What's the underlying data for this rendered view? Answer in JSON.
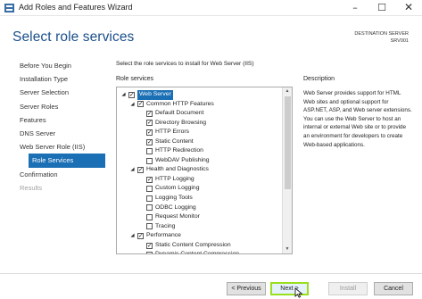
{
  "window": {
    "title": "Add Roles and Features Wizard",
    "controls": {
      "minimize": "–",
      "maximize": "☐",
      "close": "✕"
    }
  },
  "header": {
    "page_title": "Select role services",
    "destination_label": "DESTINATION SERVER",
    "destination_name": "SRV001"
  },
  "nav": {
    "items": [
      {
        "label": "Before You Begin",
        "state": "normal"
      },
      {
        "label": "Installation Type",
        "state": "normal"
      },
      {
        "label": "Server Selection",
        "state": "normal"
      },
      {
        "label": "Server Roles",
        "state": "normal"
      },
      {
        "label": "Features",
        "state": "normal"
      },
      {
        "label": "DNS Server",
        "state": "normal"
      },
      {
        "label": "Web Server Role (IIS)",
        "state": "normal"
      },
      {
        "label": "Role Services",
        "state": "active"
      },
      {
        "label": "Confirmation",
        "state": "normal"
      },
      {
        "label": "Results",
        "state": "disabled"
      }
    ]
  },
  "main": {
    "instruction": "Select the role services to install for Web Server (IIS)",
    "role_services_label": "Role services",
    "tree": [
      {
        "label": "Web Server",
        "level": 0,
        "checked": true,
        "expanded": true,
        "highlighted": true
      },
      {
        "label": "Common HTTP Features",
        "level": 1,
        "checked": true,
        "expanded": true
      },
      {
        "label": "Default Document",
        "level": 2,
        "checked": true
      },
      {
        "label": "Directory Browsing",
        "level": 2,
        "checked": true
      },
      {
        "label": "HTTP Errors",
        "level": 2,
        "checked": true
      },
      {
        "label": "Static Content",
        "level": 2,
        "checked": true
      },
      {
        "label": "HTTP Redirection",
        "level": 2,
        "checked": false
      },
      {
        "label": "WebDAV Publishing",
        "level": 2,
        "checked": false
      },
      {
        "label": "Health and Diagnostics",
        "level": 1,
        "checked": true,
        "expanded": true
      },
      {
        "label": "HTTP Logging",
        "level": 2,
        "checked": true
      },
      {
        "label": "Custom Logging",
        "level": 2,
        "checked": false
      },
      {
        "label": "Logging Tools",
        "level": 2,
        "checked": false
      },
      {
        "label": "ODBC Logging",
        "level": 2,
        "checked": false
      },
      {
        "label": "Request Monitor",
        "level": 2,
        "checked": false
      },
      {
        "label": "Tracing",
        "level": 2,
        "checked": false
      },
      {
        "label": "Performance",
        "level": 1,
        "checked": true,
        "expanded": true
      },
      {
        "label": "Static Content Compression",
        "level": 2,
        "checked": true
      },
      {
        "label": "Dynamic Content Compression",
        "level": 2,
        "checked": false
      },
      {
        "label": "Security",
        "level": 1,
        "checked": true,
        "expanded": true
      }
    ],
    "description_label": "Description",
    "description_text": "Web Server provides support for HTML Web sites and optional support for ASP.NET, ASP, and Web server extensions. You can use the Web Server to host an internal or external Web site or to provide an environment for developers to create Web-based applications."
  },
  "footer": {
    "previous": "< Previous",
    "next": "Next >",
    "install": "Install",
    "cancel": "Cancel"
  },
  "icons": {
    "expand_open": "◢",
    "check": "✓",
    "scroll_up": "▲",
    "scroll_down": "▼"
  }
}
